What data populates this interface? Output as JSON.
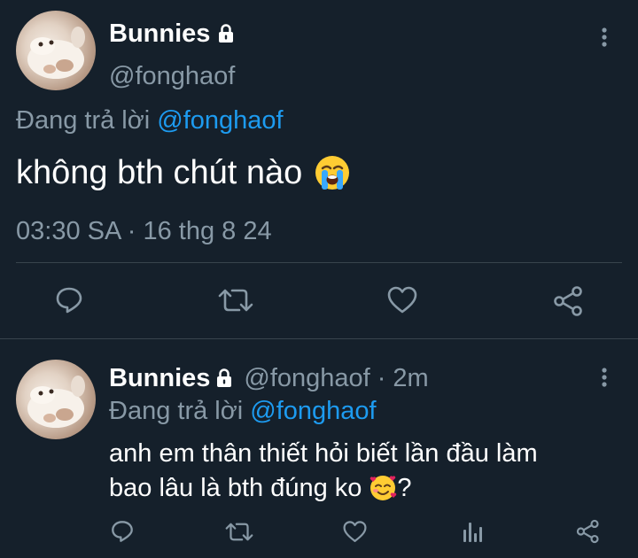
{
  "main_tweet": {
    "display_name": "Bunnies",
    "handle": "@fonghaof",
    "reply_prefix": "Đang trả lời",
    "reply_to": "@fonghaof",
    "text": "không bth chút nào",
    "emoji": "loudly-crying-face",
    "timestamp": "03:30 SA · 16 thg 8 24"
  },
  "reply_tweet": {
    "display_name": "Bunnies",
    "handle": "@fonghaof",
    "separator": "·",
    "age": "2m",
    "reply_prefix": "Đang trả lời",
    "reply_to": "@fonghaof",
    "text_line1": "anh em thân thiết hỏi biết lần đầu làm",
    "text_line2": "bao lâu là bth đúng ko",
    "emoji": "smiling-face-with-hearts",
    "text_suffix": "?"
  },
  "colors": {
    "background": "#15202b",
    "text": "#ffffff",
    "muted": "#8899a6",
    "link": "#1d9bf0",
    "divider": "#38444d"
  }
}
